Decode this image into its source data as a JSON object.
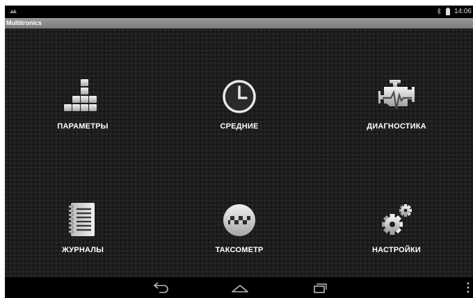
{
  "statusbar": {
    "time": "14:06"
  },
  "app": {
    "title": "Multitronics"
  },
  "tiles": [
    {
      "label": "ПАРАМЕТРЫ",
      "icon": "parameters-blocks-icon"
    },
    {
      "label": "СРЕДНИЕ",
      "icon": "clock-icon"
    },
    {
      "label": "ДИАГНОСТИКА",
      "icon": "engine-diagnostics-icon"
    },
    {
      "label": "ЖУРНАЛЫ",
      "icon": "notebook-icon"
    },
    {
      "label": "ТАКСОМЕТР",
      "icon": "taxi-icon"
    },
    {
      "label": "НАСТРОЙКИ",
      "icon": "gears-icon"
    }
  ],
  "navbar": {
    "back": "back-icon",
    "home": "home-icon",
    "recents": "recent-apps-icon",
    "menu": "overflow-menu-icon"
  }
}
